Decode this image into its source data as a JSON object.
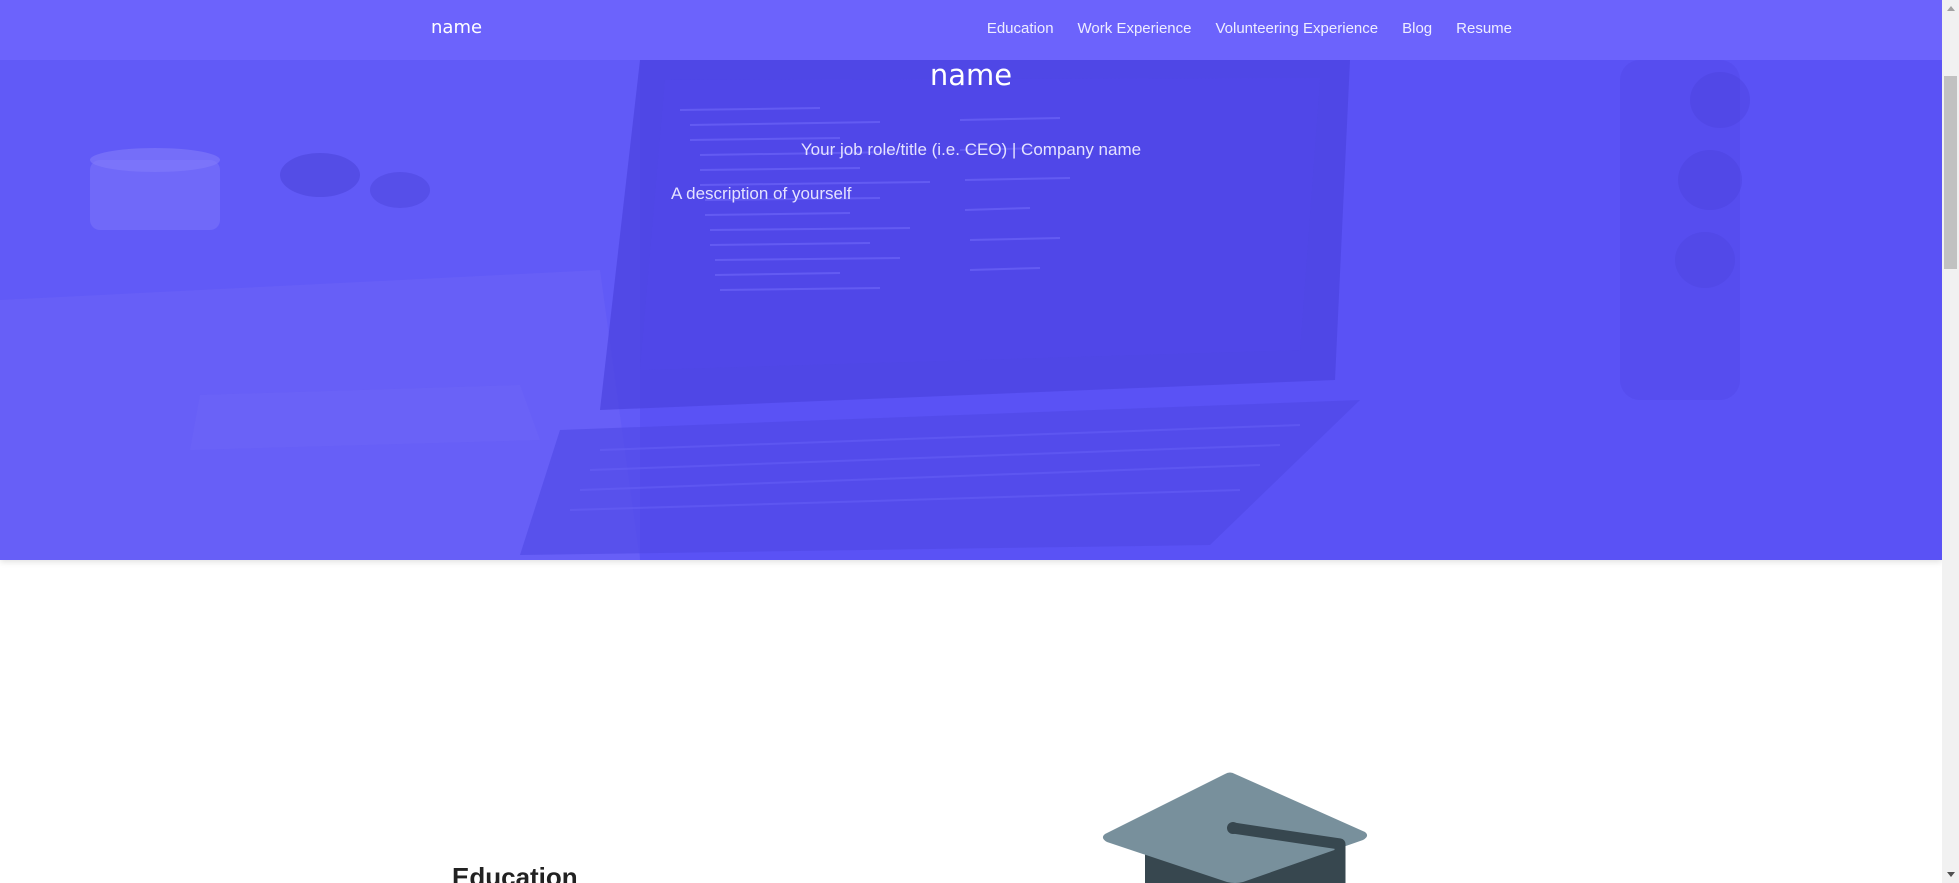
{
  "nav": {
    "brand": "name",
    "links": [
      {
        "label": "Education"
      },
      {
        "label": "Work Experience"
      },
      {
        "label": "Volunteering Experience"
      },
      {
        "label": "Blog"
      },
      {
        "label": "Resume"
      }
    ]
  },
  "hero": {
    "title": "name",
    "role": "Your job role/title (i.e. CEO) | Company name",
    "description": "A description of yourself",
    "background_image": "desk-laptop-photo",
    "overlay_color": "#5a52f5"
  },
  "education": {
    "heading": "Education",
    "icon": "graduation-cap-icon"
  },
  "colors": {
    "navbar": "#6c63fc",
    "hero": "#5a52f5",
    "cap_top": "#78909c",
    "cap_dark": "#37474f"
  }
}
